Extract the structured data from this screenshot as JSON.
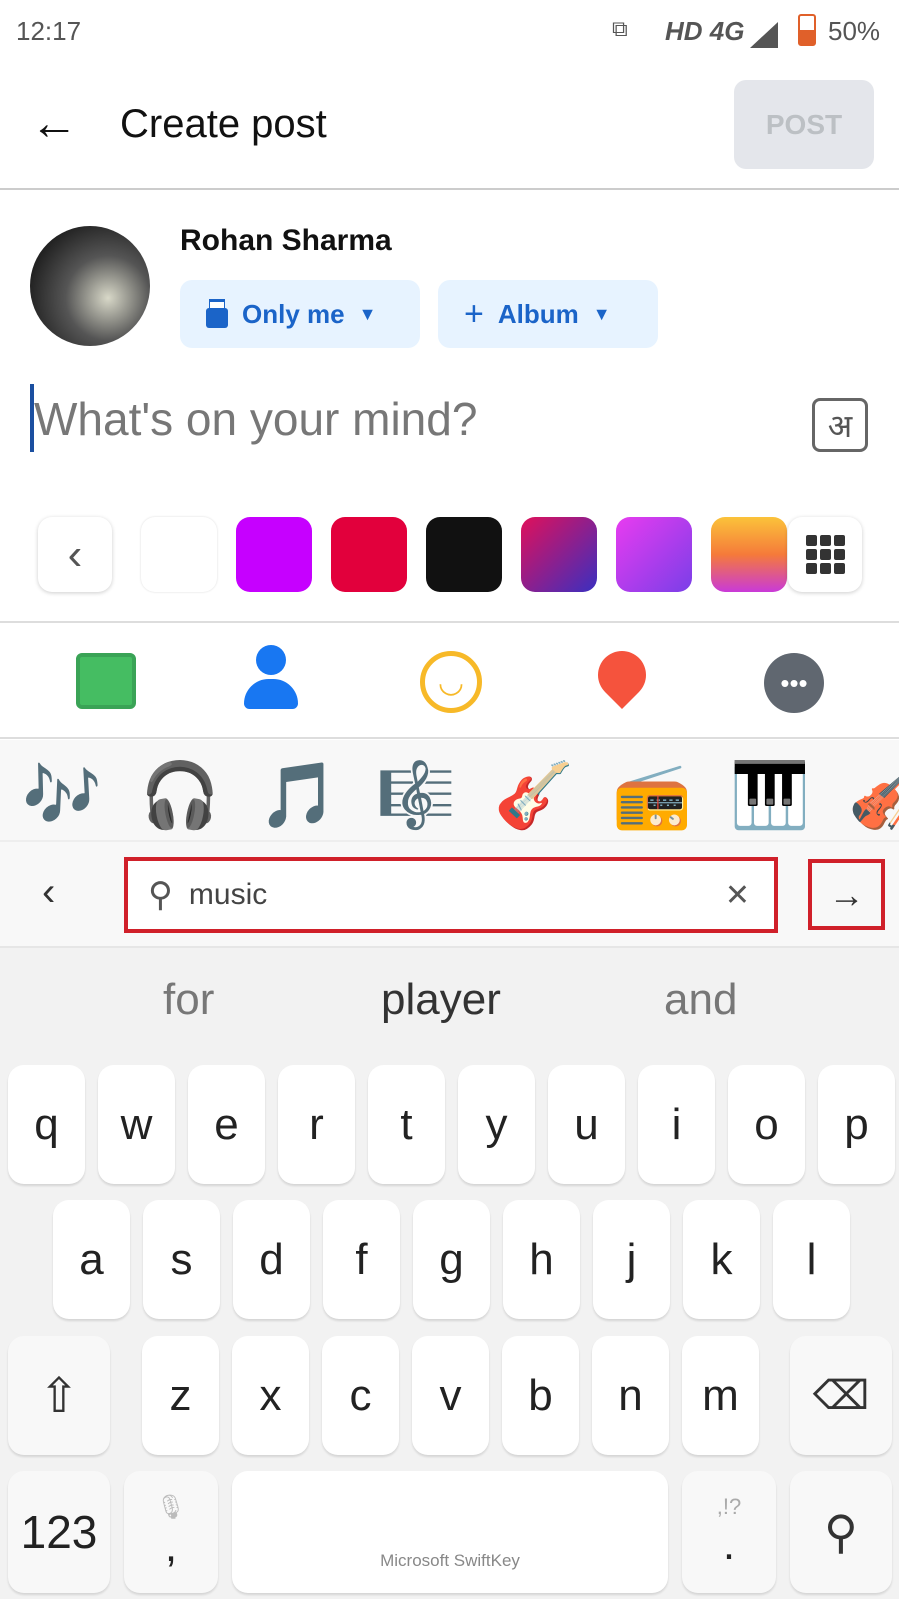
{
  "status_bar": {
    "time": "12:17",
    "network": "HD 4G",
    "battery": "50%"
  },
  "header": {
    "title": "Create post",
    "post_label": "POST"
  },
  "user": {
    "name": "Rohan Sharma",
    "privacy": "Only me",
    "album": "Album"
  },
  "composer": {
    "placeholder": "What's on your mind?",
    "script_button": "अ"
  },
  "backgrounds": {
    "colors": [
      "#ffffff",
      "#c600ff",
      "#e2003c",
      "#111111",
      "linear-gradient(135deg,#e0105a,#3a2fc0)",
      "linear-gradient(135deg,#e83cf0,#7a3ee8)",
      "linear-gradient(180deg,#fbc33a,#f57a3a,#c93ad8)"
    ]
  },
  "actions": [
    "photo",
    "tag-people",
    "feeling",
    "check-in",
    "more"
  ],
  "emoji_results": [
    "🎶",
    "🎧",
    "🎵",
    "🎼",
    "🎸",
    "📻",
    "🎹",
    "🎻"
  ],
  "emoji_search": {
    "query": "music"
  },
  "suggestions": [
    "for",
    "player",
    "and"
  ],
  "keyboard": {
    "row1": [
      "q",
      "w",
      "e",
      "r",
      "t",
      "y",
      "u",
      "i",
      "o",
      "p"
    ],
    "row2": [
      "a",
      "s",
      "d",
      "f",
      "g",
      "h",
      "j",
      "k",
      "l"
    ],
    "row3": [
      "z",
      "x",
      "c",
      "v",
      "b",
      "n",
      "m"
    ],
    "numbers": "123",
    "comma": ",",
    "space": "Microsoft SwiftKey",
    "period": ".",
    "punct_hint": ",!?"
  },
  "accent": "#1877f2"
}
